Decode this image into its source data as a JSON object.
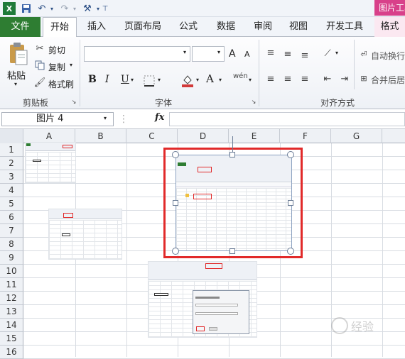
{
  "title_bar": {
    "picture_tools_label": "图片工具"
  },
  "tabs": [
    "文件",
    "开始",
    "插入",
    "页面布局",
    "公式",
    "数据",
    "审阅",
    "视图",
    "开发工具",
    "格式"
  ],
  "clipboard": {
    "paste": "粘贴",
    "cut": "剪切",
    "copy": "复制",
    "format_painter": "格式刷",
    "group": "剪贴板"
  },
  "font": {
    "group": "字体",
    "bold": "B",
    "italic": "I",
    "underline": "U",
    "grow": "A",
    "shrink": "A",
    "color_a": "A",
    "wen": "wén"
  },
  "alignment": {
    "group": "对齐方式",
    "wrap": "自动换行",
    "merge": "合并后居"
  },
  "formula_bar": {
    "name_box": "图片 4",
    "fx": "fx"
  },
  "columns": [
    "A",
    "B",
    "C",
    "D",
    "E",
    "F",
    "G"
  ],
  "rows": [
    "1",
    "2",
    "3",
    "4",
    "5",
    "6",
    "7",
    "8",
    "9",
    "10",
    "11",
    "12",
    "13",
    "14",
    "15",
    "16"
  ],
  "watermark": "经验"
}
